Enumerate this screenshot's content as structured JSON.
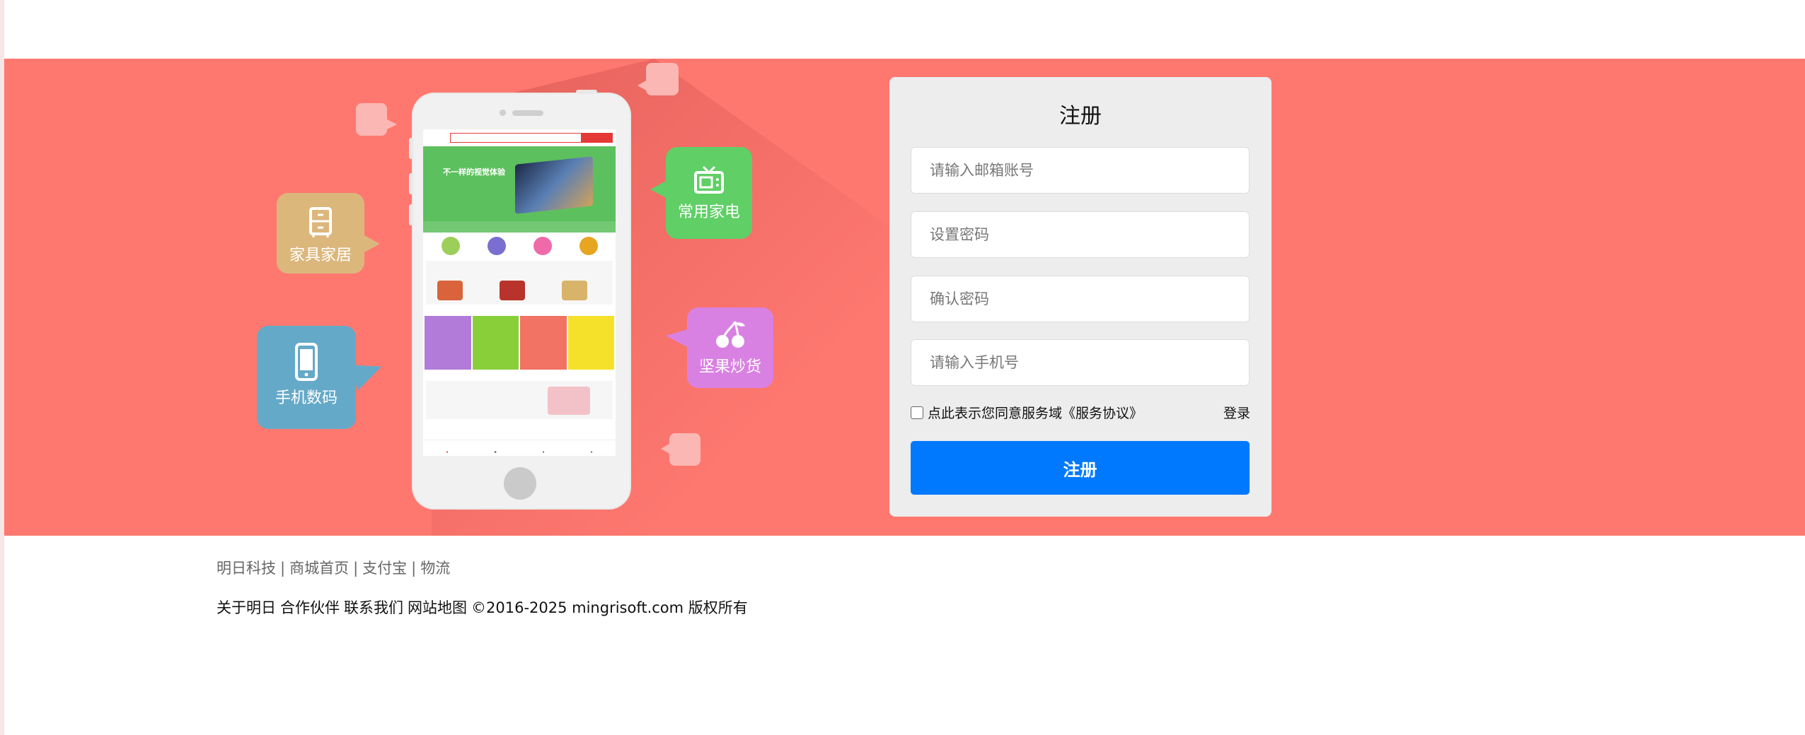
{
  "banner": {
    "background_color": "#fe7870",
    "categories": [
      {
        "label": "家具家居",
        "icon": "cabinet-icon",
        "color": "#dcb77c"
      },
      {
        "label": "手机数码",
        "icon": "smartphone-icon",
        "color": "#65a9c8"
      },
      {
        "label": "常用家电",
        "icon": "tv-icon",
        "color": "#5fcf66"
      },
      {
        "label": "坚果炒货",
        "icon": "cherry-icon",
        "color": "#d981e3"
      }
    ],
    "phone_screen": {
      "hero_title": "不一样的视觉体验"
    }
  },
  "register_form": {
    "title": "注册",
    "email_placeholder": "请输入邮箱账号",
    "password_placeholder": "设置密码",
    "confirm_placeholder": "确认密码",
    "phone_placeholder": "请输入手机号",
    "agreement_text": "点此表示您同意服务域《服务协议》",
    "login_link": "登录",
    "submit_label": "注册",
    "submit_color": "#0079fe"
  },
  "footer": {
    "links": [
      "明日科技",
      "商城首页",
      "支付宝",
      "物流"
    ],
    "info": [
      "关于明日",
      "合作伙伴",
      "联系我们",
      "网站地图",
      "©2016-2025 mingrisoft.com 版权所有"
    ]
  }
}
